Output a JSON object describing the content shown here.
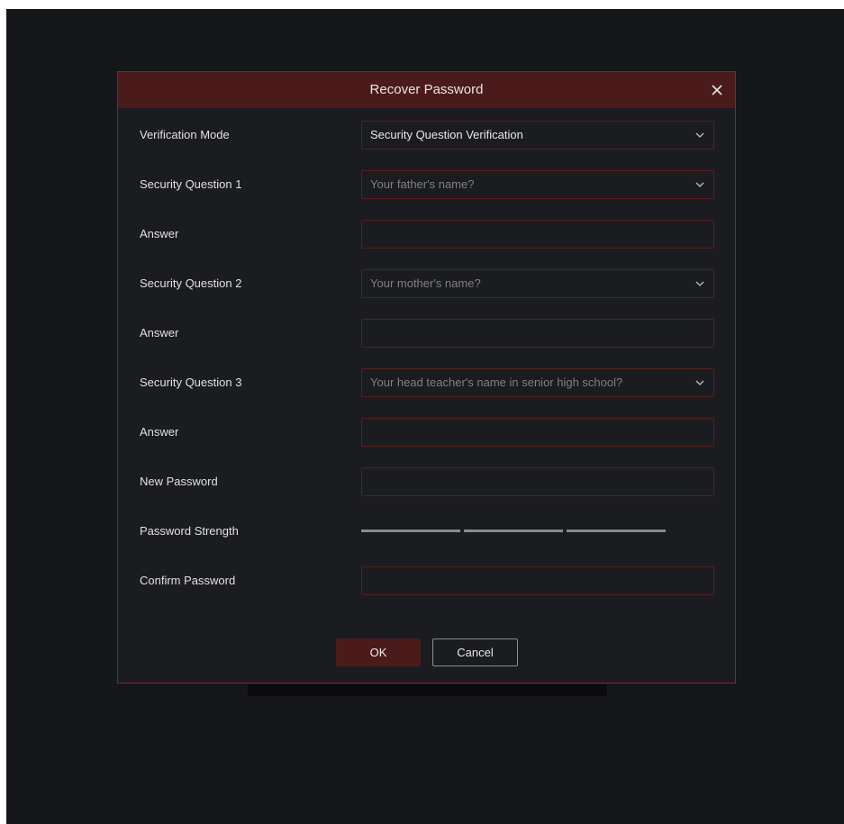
{
  "dialog": {
    "title": "Recover Password",
    "close_icon": "close-icon"
  },
  "form": {
    "verification_mode": {
      "label": "Verification Mode",
      "value": "Security Question Verification"
    },
    "question1": {
      "label": "Security Question 1",
      "value": "Your father's name?"
    },
    "answer1": {
      "label": "Answer",
      "value": ""
    },
    "question2": {
      "label": "Security Question 2",
      "value": "Your mother's name?"
    },
    "answer2": {
      "label": "Answer",
      "value": ""
    },
    "question3": {
      "label": "Security Question 3",
      "value": "Your head teacher's name in senior high school?"
    },
    "answer3": {
      "label": "Answer",
      "value": ""
    },
    "new_password": {
      "label": "New Password",
      "value": ""
    },
    "password_strength": {
      "label": "Password Strength",
      "level": 0,
      "segments": 3
    },
    "confirm_password": {
      "label": "Confirm Password",
      "value": ""
    }
  },
  "buttons": {
    "ok_label": "OK",
    "cancel_label": "Cancel"
  },
  "colors": {
    "background": "#16171b",
    "dialog_border": "#8e2323",
    "header": "#4b1b1b",
    "field_border": "#5a1d1d",
    "strength_bar": "#8b8b8e"
  }
}
